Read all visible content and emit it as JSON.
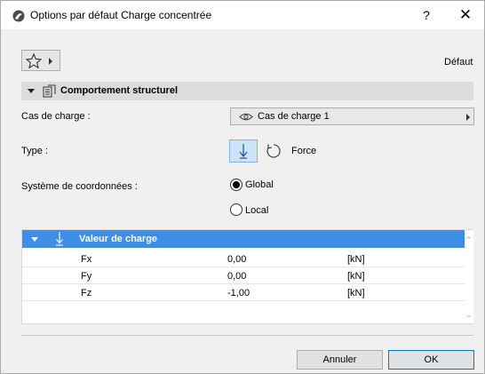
{
  "window": {
    "title": "Options par défaut Charge concentrée",
    "help_label": "?",
    "close_label": "✕"
  },
  "toolbar": {
    "favorites_icon": "star-icon",
    "default_label": "Défaut"
  },
  "section": {
    "title": "Comportement structurel",
    "icon": "structural-settings-icon"
  },
  "load_case": {
    "label": "Cas de charge :",
    "value": "Cas de charge 1",
    "icon": "eye-icon"
  },
  "type": {
    "label": "Type :",
    "selected": "force",
    "options": [
      "force",
      "moment"
    ],
    "value_label": "Force"
  },
  "coordinate_system": {
    "label": "Système de coordonnées :",
    "options": [
      {
        "label": "Global",
        "checked": true
      },
      {
        "label": "Local",
        "checked": false
      }
    ]
  },
  "load_table": {
    "header": "Valeur de charge",
    "rows": [
      {
        "name": "Fx",
        "value": "0,00",
        "unit": "[kN]"
      },
      {
        "name": "Fy",
        "value": "0,00",
        "unit": "[kN]"
      },
      {
        "name": "Fz",
        "value": "-1,00",
        "unit": "[kN]"
      }
    ]
  },
  "buttons": {
    "cancel": "Annuler",
    "ok": "OK"
  },
  "colors": {
    "table_header_bg": "#3d8ee6",
    "selected_type_bg": "#cce4f7",
    "default_button_border": "#0078d7"
  }
}
